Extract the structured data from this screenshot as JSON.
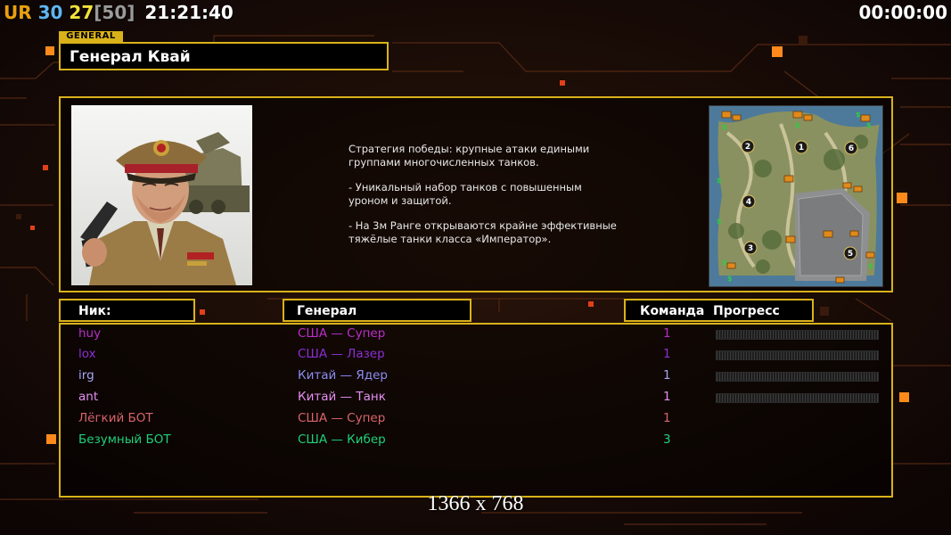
{
  "hud": {
    "tag": "UR",
    "num1": "30",
    "num2": "27",
    "num3": "[50]",
    "clock": "21:21:40",
    "timer": "00:00:00"
  },
  "general": {
    "section_label": "GENERAL",
    "name": "Генерал Квай",
    "description": [
      "Стратегия победы: крупные атаки едиными\n группами многочисленных танков.",
      "- Уникальный набор танков с повышенным\n уроном и защитой.",
      "- На 3м Ранге открываются крайне эффективные\n тяжёлые танки класса «Император»."
    ]
  },
  "minimap": {
    "positions": [
      "2",
      "1",
      "6",
      "4",
      "3",
      "5"
    ]
  },
  "table": {
    "headers": {
      "nick": "Ник:",
      "general": "Генерал",
      "team": "Команда",
      "progress": "Прогресс"
    },
    "rows": [
      {
        "nick": "huy",
        "general": "США — Супер",
        "team": "1",
        "nick_color": "#b92ec9",
        "gen_color": "#b92ec9",
        "team_color": "#b92ec9",
        "progress": 0
      },
      {
        "nick": "lox",
        "general": "США — Лазер",
        "team": "1",
        "nick_color": "#8d2ed3",
        "gen_color": "#8d2ed3",
        "team_color": "#8d2ed3",
        "progress": 0
      },
      {
        "nick": "irg",
        "general": "Китай — Ядер",
        "team": "1",
        "nick_color": "#a7a7f5",
        "gen_color": "#8c8cf0",
        "team_color": "#a7a7f5",
        "progress": 0
      },
      {
        "nick": "ant",
        "general": "Китай — Танк",
        "team": "1",
        "nick_color": "#e58ef0",
        "gen_color": "#e58ef0",
        "team_color": "#e58ef0",
        "progress": 0
      },
      {
        "nick": "Лёгкий БОТ",
        "general": "США — Супер",
        "team": "1",
        "nick_color": "#d8656b",
        "gen_color": "#d8656b",
        "team_color": "#d8656b",
        "progress": null
      },
      {
        "nick": "Безумный БОТ",
        "general": "США — Кибер",
        "team": "3",
        "nick_color": "#1ed17a",
        "gen_color": "#1ed17a",
        "team_color": "#1ed17a",
        "progress": null
      }
    ]
  },
  "resolution": "1366 x 768",
  "colors": {
    "accent": "#d9b21a",
    "hud_tag": "#e8a010",
    "hud_num1": "#5fb6f2",
    "hud_num2": "#f2e23c",
    "hud_num3": "#9a9a9a"
  }
}
